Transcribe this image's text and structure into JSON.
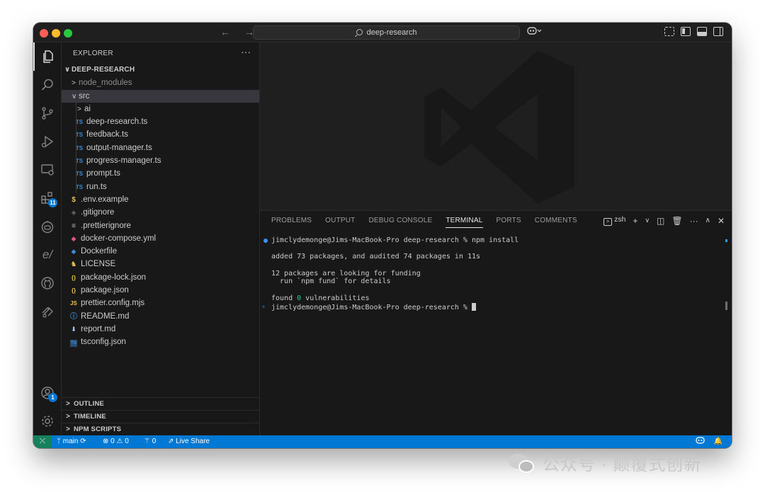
{
  "titlebar": {
    "search_text": "deep-research",
    "nav_arrows": "← →"
  },
  "sidebar": {
    "title": "EXPLORER",
    "more": "···",
    "root": "DEEP-RESEARCH",
    "items": [
      {
        "label": "node_modules",
        "icon": "",
        "chev": ">"
      },
      {
        "label": "src",
        "icon": "",
        "chev": "∨"
      },
      {
        "label": "ai",
        "icon": "",
        "chev": ">"
      },
      {
        "label": "deep-research.ts",
        "icon": "TS"
      },
      {
        "label": "feedback.ts",
        "icon": "TS"
      },
      {
        "label": "output-manager.ts",
        "icon": "TS"
      },
      {
        "label": "progress-manager.ts",
        "icon": "TS"
      },
      {
        "label": "prompt.ts",
        "icon": "TS"
      },
      {
        "label": "run.ts",
        "icon": "TS"
      },
      {
        "label": ".env.example",
        "icon": "$"
      },
      {
        "label": ".gitignore",
        "icon": "◈"
      },
      {
        "label": ".prettierignore",
        "icon": "≡"
      },
      {
        "label": "docker-compose.yml",
        "icon": "🐳"
      },
      {
        "label": "Dockerfile",
        "icon": "🐳"
      },
      {
        "label": "LICENSE",
        "icon": "🎗"
      },
      {
        "label": "package-lock.json",
        "icon": "{}"
      },
      {
        "label": "package.json",
        "icon": "{}"
      },
      {
        "label": "prettier.config.mjs",
        "icon": "JS"
      },
      {
        "label": "README.md",
        "icon": "ⓘ"
      },
      {
        "label": "report.md",
        "icon": "⬇"
      },
      {
        "label": "tsconfig.json",
        "icon": "TS"
      }
    ],
    "sections": [
      "OUTLINE",
      "TIMELINE",
      "NPM SCRIPTS"
    ]
  },
  "activity": {
    "extensions_badge": "11",
    "accounts_badge": "1",
    "extension_label": "e/"
  },
  "panel": {
    "tabs": [
      "PROBLEMS",
      "OUTPUT",
      "DEBUG CONSOLE",
      "TERMINAL",
      "PORTS",
      "COMMENTS"
    ],
    "shell": "zsh",
    "terminal": {
      "line1": "jimclydemonge@Jims-MacBook-Pro deep-research % npm install",
      "line2": "added 73 packages, and audited 74 packages in 11s",
      "line3": "12 packages are looking for funding",
      "line4": "  run `npm fund` for details",
      "line5_pre": "found ",
      "line5_num": "0",
      "line5_post": " vulnerabilities",
      "line6": "jimclydemonge@Jims-MacBook-Pro deep-research % "
    }
  },
  "statusbar": {
    "branch": "main",
    "errors": "0",
    "warnings": "0",
    "ports": "0",
    "live_share": "Live Share"
  },
  "watermark": {
    "text": "公众号 · 颠覆式创新"
  },
  "colors": {
    "accent": "#0078d4",
    "ts_icon": "#3c8cd6",
    "success": "#23d18b"
  }
}
